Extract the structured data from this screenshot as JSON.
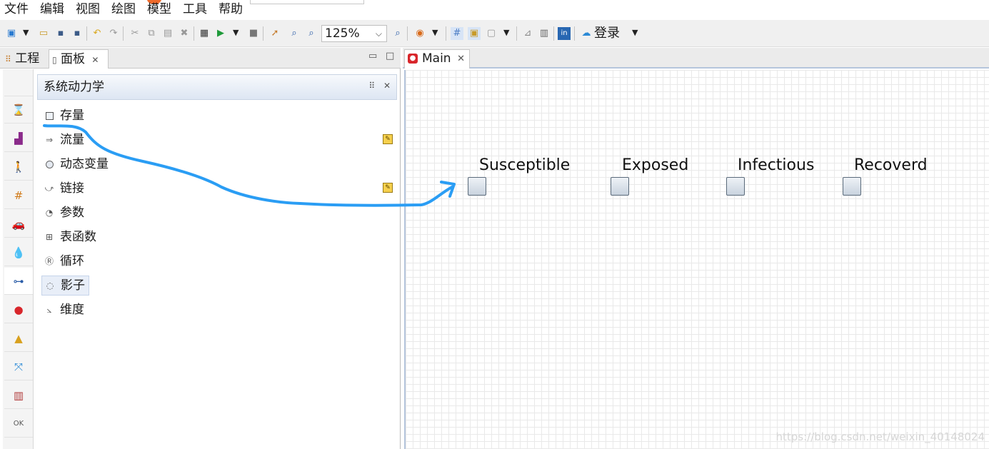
{
  "menu": [
    "文件",
    "编辑",
    "视图",
    "绘图",
    "模型",
    "工具",
    "帮助"
  ],
  "toolbar": {
    "zoom_value": "125%",
    "login_label": "登录"
  },
  "left_tabs": {
    "project": "工程",
    "palette": "面板"
  },
  "palette": {
    "title": "系统动力学",
    "items": [
      {
        "label": "存量",
        "icon": "stock-icon"
      },
      {
        "label": "流量",
        "icon": "flow-icon"
      },
      {
        "label": "动态变量",
        "icon": "dynamic-variable-icon"
      },
      {
        "label": "链接",
        "icon": "link-icon"
      },
      {
        "label": "参数",
        "icon": "parameter-icon"
      },
      {
        "label": "表函数",
        "icon": "table-function-icon"
      },
      {
        "label": "循环",
        "icon": "loop-icon"
      },
      {
        "label": "影子",
        "icon": "shadow-icon"
      },
      {
        "label": "维度",
        "icon": "dimension-icon"
      }
    ]
  },
  "editor_tab": {
    "label": "Main"
  },
  "canvas": {
    "stocks": [
      {
        "label": "Susceptible"
      },
      {
        "label": "Exposed"
      },
      {
        "label": "Infectious"
      },
      {
        "label": "Recoverd"
      }
    ]
  },
  "watermark": "https://blog.csdn.net/weixin_40148024",
  "colors": {
    "annotation_arrow": "#2a9df4",
    "grid_line": "#e9e9e9",
    "palette_header": "#dde6f3"
  }
}
